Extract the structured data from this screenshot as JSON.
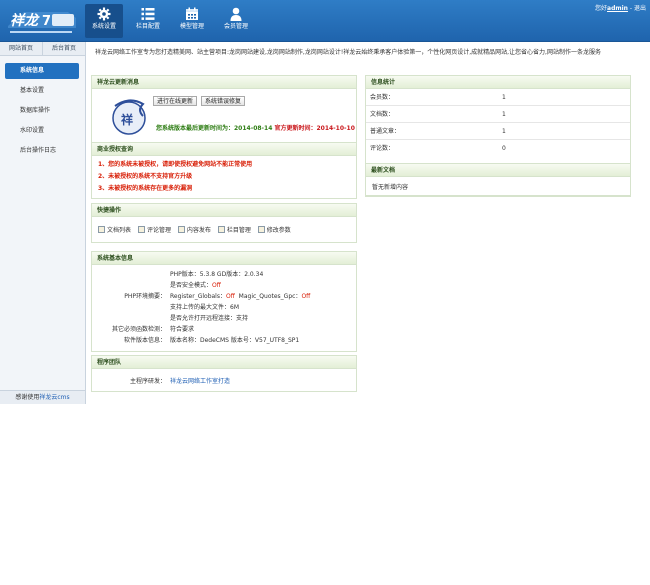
{
  "header": {
    "user_prefix": "您好",
    "user": "admin",
    "separator": "-",
    "logout": "退出",
    "nav": [
      {
        "label": "系统设置",
        "icon": "gear-icon"
      },
      {
        "label": "栏目配置",
        "icon": "list-icon"
      },
      {
        "label": "模型管理",
        "icon": "calendar-icon"
      },
      {
        "label": "会员管理",
        "icon": "user-icon"
      }
    ]
  },
  "sidebar": {
    "tabs": [
      "网站首页",
      "后台首页"
    ],
    "items": [
      "系统信息",
      "基本设置",
      "数据库操作",
      "水印设置",
      "后台操作日志"
    ],
    "footer_prefix": "感谢使用",
    "footer_link": "祥龙云cms"
  },
  "main": {
    "intro": "祥龙云网络工作室专为您打造精美网、站主营项目:龙岗网站建设,龙岗网站制作,龙岗网站设计!祥龙云始终秉承客户体验第一，个性化网页设计,成就精品网站,让您省心省力,网站制作一条龙服务",
    "update": {
      "title": "祥龙云更新消息",
      "btn_online": "进行在线更新",
      "btn_repair": "系统错误修复",
      "version_text": "您系统版本最后更新时间为：2014-08-14",
      "official_text": "官方更新时间：2014-10-10"
    },
    "auth": {
      "title": "商业授权查询",
      "lines": [
        "1、您的系统未被授权，请即使授权避免网站不能正常使用",
        "2、未被授权的系统不支持官方升级",
        "3、未被授权的系统存在更多的漏洞"
      ]
    },
    "quick": {
      "title": "快捷操作",
      "items": [
        "文档列表",
        "评论管理",
        "内容发布",
        "栏目管理",
        "修改参数"
      ]
    },
    "sysinfo": {
      "title": "系统基本信息",
      "php_line": "PHP版本：5.3.8  GD版本：2.0.34",
      "safe_mode_label": "是否安全模式：",
      "safe_mode_value": "Off",
      "env_label": "PHP环境摘要：",
      "globals_label": "Register_Globals：",
      "globals_value": "Off",
      "magic_label": "Magic_Quotes_Gpc：",
      "magic_value": "Off",
      "upload_line": "支持上传的最大文件：6M",
      "remote_line": "是否允许打开远程连接：支持",
      "other_label": "其它必须函数检测：",
      "other_value": "符合要求",
      "software_label": "软件版本信息：",
      "software_value": "版本名称：DedeCMS  版本号：V57_UTF8_SP1"
    },
    "team": {
      "title": "程序团队",
      "dev_label": "主程序研发：",
      "dev_value": "祥龙云网络工作室打造"
    },
    "stats": {
      "title": "信息统计",
      "rows": [
        {
          "label": "会员数：",
          "value": "1"
        },
        {
          "label": "文档数：",
          "value": "1"
        },
        {
          "label": "普通文章：",
          "value": "1"
        },
        {
          "label": "评论数：",
          "value": "0"
        }
      ]
    },
    "docs": {
      "title": "最新文档",
      "empty": "暂无新增内容"
    }
  },
  "colors": {
    "header_blue": "#2271c0",
    "panel_green": "#e3efd6",
    "warning_red": "#d81e06"
  }
}
